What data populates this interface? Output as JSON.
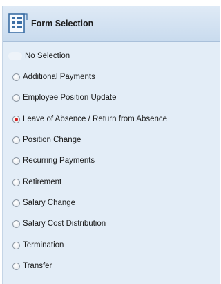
{
  "header": {
    "title": "Form Selection",
    "icon": "form-list-icon"
  },
  "options": [
    {
      "label": "No Selection",
      "checked": false
    },
    {
      "label": "Additional Payments",
      "checked": false
    },
    {
      "label": "Employee Position Update",
      "checked": false
    },
    {
      "label": "Leave of Absence / Return from Absence",
      "checked": true
    },
    {
      "label": "Position Change",
      "checked": false
    },
    {
      "label": "Recurring Payments",
      "checked": false
    },
    {
      "label": "Retirement",
      "checked": false
    },
    {
      "label": "Salary Change",
      "checked": false
    },
    {
      "label": "Salary Cost Distribution",
      "checked": false
    },
    {
      "label": "Termination",
      "checked": false
    },
    {
      "label": "Transfer",
      "checked": false
    }
  ],
  "colors": {
    "panel_bg": "#e3edf7",
    "selected_dot": "#d42020"
  }
}
